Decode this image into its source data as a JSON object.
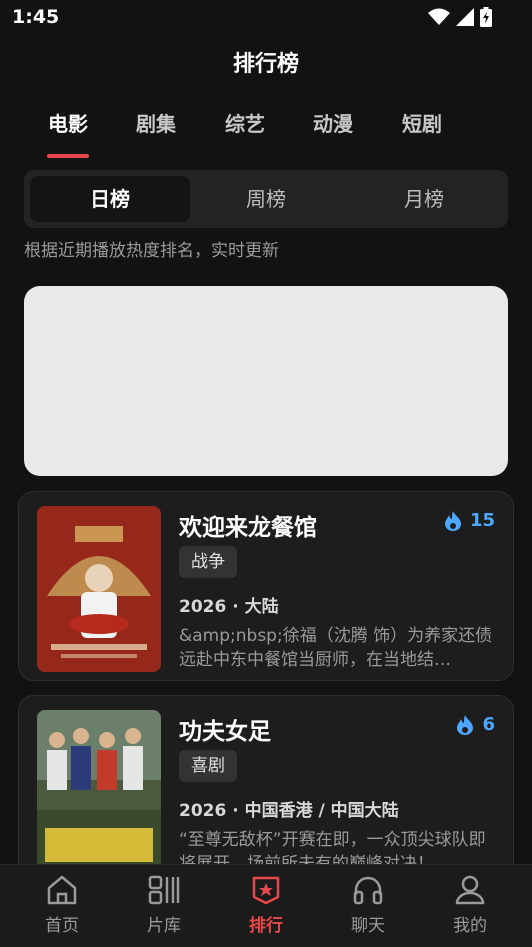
{
  "status_bar": {
    "time": "1:45"
  },
  "page": {
    "title": "排行榜"
  },
  "category_tabs": [
    {
      "label": "电影",
      "active": true
    },
    {
      "label": "剧集"
    },
    {
      "label": "综艺"
    },
    {
      "label": "动漫"
    },
    {
      "label": "短剧"
    }
  ],
  "period_tabs": [
    {
      "label": "日榜",
      "active": true
    },
    {
      "label": "周榜"
    },
    {
      "label": "月榜"
    }
  ],
  "subtitle": "根据近期播放热度排名，实时更新",
  "items": [
    {
      "title": "欢迎来龙餐馆",
      "heat": "15",
      "tag": "战争",
      "meta": "2026 · 大陆",
      "desc": "&amp;nbsp;徐福（沈腾 饰）为养家还债远赴中东中餐馆当厨师，在当地结…"
    },
    {
      "title": "功夫女足",
      "heat": "6",
      "tag": "喜剧",
      "meta": "2026 · 中国香港 / 中国大陆",
      "desc": "“至尊无敌杯”开赛在即，一众顶尖球队即将展开，场前所未有的巅峰对决！"
    }
  ],
  "bottom_nav": [
    {
      "label": "首页",
      "icon": "home-icon"
    },
    {
      "label": "片库",
      "icon": "library-icon"
    },
    {
      "label": "排行",
      "icon": "ranking-icon",
      "active": true
    },
    {
      "label": "聊天",
      "icon": "headset-icon"
    },
    {
      "label": "我的",
      "icon": "user-icon"
    }
  ],
  "colors": {
    "accent": "#e9474b",
    "heat": "#4da6ff",
    "background": "#121212"
  }
}
